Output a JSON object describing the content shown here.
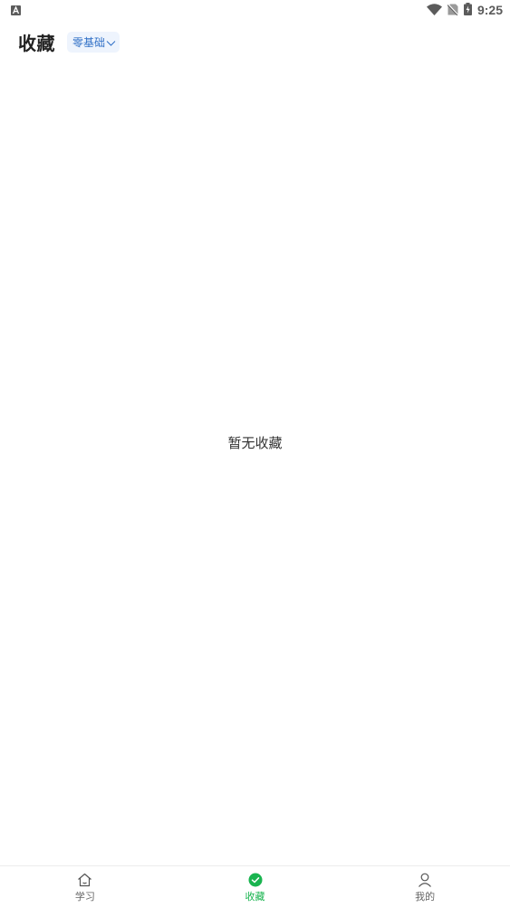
{
  "status_bar": {
    "time": "9:25",
    "left_icon": "a-keyboard-icon",
    "icons": [
      "wifi-icon",
      "no-sim-icon",
      "battery-charging-icon"
    ]
  },
  "header": {
    "title": "收藏",
    "level_select": {
      "selected": "零基础"
    }
  },
  "main": {
    "empty_text": "暂无收藏"
  },
  "bottom_nav": {
    "items": [
      {
        "label": "学习",
        "icon": "home-icon",
        "active": false
      },
      {
        "label": "收藏",
        "icon": "check-circle-icon",
        "active": true
      },
      {
        "label": "我的",
        "icon": "person-icon",
        "active": false
      }
    ]
  },
  "colors": {
    "accent_green": "#19b44f",
    "select_bg": "#eef4fd",
    "select_text": "#2f6fc6"
  }
}
